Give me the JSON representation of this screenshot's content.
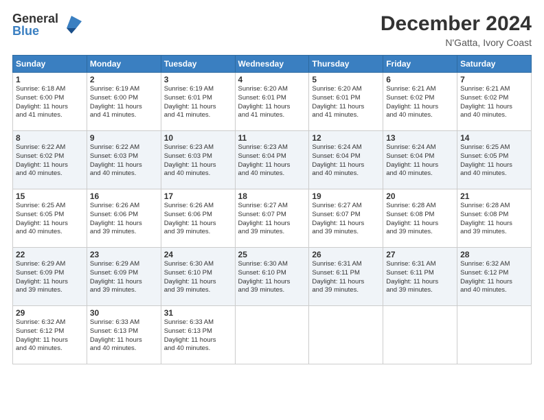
{
  "header": {
    "logo_general": "General",
    "logo_blue": "Blue",
    "month_title": "December 2024",
    "location": "N'Gatta, Ivory Coast"
  },
  "weekdays": [
    "Sunday",
    "Monday",
    "Tuesday",
    "Wednesday",
    "Thursday",
    "Friday",
    "Saturday"
  ],
  "weeks": [
    [
      {
        "day": "1",
        "lines": [
          "Sunrise: 6:18 AM",
          "Sunset: 6:00 PM",
          "Daylight: 11 hours",
          "and 41 minutes."
        ]
      },
      {
        "day": "2",
        "lines": [
          "Sunrise: 6:19 AM",
          "Sunset: 6:00 PM",
          "Daylight: 11 hours",
          "and 41 minutes."
        ]
      },
      {
        "day": "3",
        "lines": [
          "Sunrise: 6:19 AM",
          "Sunset: 6:01 PM",
          "Daylight: 11 hours",
          "and 41 minutes."
        ]
      },
      {
        "day": "4",
        "lines": [
          "Sunrise: 6:20 AM",
          "Sunset: 6:01 PM",
          "Daylight: 11 hours",
          "and 41 minutes."
        ]
      },
      {
        "day": "5",
        "lines": [
          "Sunrise: 6:20 AM",
          "Sunset: 6:01 PM",
          "Daylight: 11 hours",
          "and 41 minutes."
        ]
      },
      {
        "day": "6",
        "lines": [
          "Sunrise: 6:21 AM",
          "Sunset: 6:02 PM",
          "Daylight: 11 hours",
          "and 40 minutes."
        ]
      },
      {
        "day": "7",
        "lines": [
          "Sunrise: 6:21 AM",
          "Sunset: 6:02 PM",
          "Daylight: 11 hours",
          "and 40 minutes."
        ]
      }
    ],
    [
      {
        "day": "8",
        "lines": [
          "Sunrise: 6:22 AM",
          "Sunset: 6:02 PM",
          "Daylight: 11 hours",
          "and 40 minutes."
        ]
      },
      {
        "day": "9",
        "lines": [
          "Sunrise: 6:22 AM",
          "Sunset: 6:03 PM",
          "Daylight: 11 hours",
          "and 40 minutes."
        ]
      },
      {
        "day": "10",
        "lines": [
          "Sunrise: 6:23 AM",
          "Sunset: 6:03 PM",
          "Daylight: 11 hours",
          "and 40 minutes."
        ]
      },
      {
        "day": "11",
        "lines": [
          "Sunrise: 6:23 AM",
          "Sunset: 6:04 PM",
          "Daylight: 11 hours",
          "and 40 minutes."
        ]
      },
      {
        "day": "12",
        "lines": [
          "Sunrise: 6:24 AM",
          "Sunset: 6:04 PM",
          "Daylight: 11 hours",
          "and 40 minutes."
        ]
      },
      {
        "day": "13",
        "lines": [
          "Sunrise: 6:24 AM",
          "Sunset: 6:04 PM",
          "Daylight: 11 hours",
          "and 40 minutes."
        ]
      },
      {
        "day": "14",
        "lines": [
          "Sunrise: 6:25 AM",
          "Sunset: 6:05 PM",
          "Daylight: 11 hours",
          "and 40 minutes."
        ]
      }
    ],
    [
      {
        "day": "15",
        "lines": [
          "Sunrise: 6:25 AM",
          "Sunset: 6:05 PM",
          "Daylight: 11 hours",
          "and 40 minutes."
        ]
      },
      {
        "day": "16",
        "lines": [
          "Sunrise: 6:26 AM",
          "Sunset: 6:06 PM",
          "Daylight: 11 hours",
          "and 39 minutes."
        ]
      },
      {
        "day": "17",
        "lines": [
          "Sunrise: 6:26 AM",
          "Sunset: 6:06 PM",
          "Daylight: 11 hours",
          "and 39 minutes."
        ]
      },
      {
        "day": "18",
        "lines": [
          "Sunrise: 6:27 AM",
          "Sunset: 6:07 PM",
          "Daylight: 11 hours",
          "and 39 minutes."
        ]
      },
      {
        "day": "19",
        "lines": [
          "Sunrise: 6:27 AM",
          "Sunset: 6:07 PM",
          "Daylight: 11 hours",
          "and 39 minutes."
        ]
      },
      {
        "day": "20",
        "lines": [
          "Sunrise: 6:28 AM",
          "Sunset: 6:08 PM",
          "Daylight: 11 hours",
          "and 39 minutes."
        ]
      },
      {
        "day": "21",
        "lines": [
          "Sunrise: 6:28 AM",
          "Sunset: 6:08 PM",
          "Daylight: 11 hours",
          "and 39 minutes."
        ]
      }
    ],
    [
      {
        "day": "22",
        "lines": [
          "Sunrise: 6:29 AM",
          "Sunset: 6:09 PM",
          "Daylight: 11 hours",
          "and 39 minutes."
        ]
      },
      {
        "day": "23",
        "lines": [
          "Sunrise: 6:29 AM",
          "Sunset: 6:09 PM",
          "Daylight: 11 hours",
          "and 39 minutes."
        ]
      },
      {
        "day": "24",
        "lines": [
          "Sunrise: 6:30 AM",
          "Sunset: 6:10 PM",
          "Daylight: 11 hours",
          "and 39 minutes."
        ]
      },
      {
        "day": "25",
        "lines": [
          "Sunrise: 6:30 AM",
          "Sunset: 6:10 PM",
          "Daylight: 11 hours",
          "and 39 minutes."
        ]
      },
      {
        "day": "26",
        "lines": [
          "Sunrise: 6:31 AM",
          "Sunset: 6:11 PM",
          "Daylight: 11 hours",
          "and 39 minutes."
        ]
      },
      {
        "day": "27",
        "lines": [
          "Sunrise: 6:31 AM",
          "Sunset: 6:11 PM",
          "Daylight: 11 hours",
          "and 39 minutes."
        ]
      },
      {
        "day": "28",
        "lines": [
          "Sunrise: 6:32 AM",
          "Sunset: 6:12 PM",
          "Daylight: 11 hours",
          "and 40 minutes."
        ]
      }
    ],
    [
      {
        "day": "29",
        "lines": [
          "Sunrise: 6:32 AM",
          "Sunset: 6:12 PM",
          "Daylight: 11 hours",
          "and 40 minutes."
        ]
      },
      {
        "day": "30",
        "lines": [
          "Sunrise: 6:33 AM",
          "Sunset: 6:13 PM",
          "Daylight: 11 hours",
          "and 40 minutes."
        ]
      },
      {
        "day": "31",
        "lines": [
          "Sunrise: 6:33 AM",
          "Sunset: 6:13 PM",
          "Daylight: 11 hours",
          "and 40 minutes."
        ]
      },
      {
        "day": "",
        "lines": []
      },
      {
        "day": "",
        "lines": []
      },
      {
        "day": "",
        "lines": []
      },
      {
        "day": "",
        "lines": []
      }
    ]
  ]
}
